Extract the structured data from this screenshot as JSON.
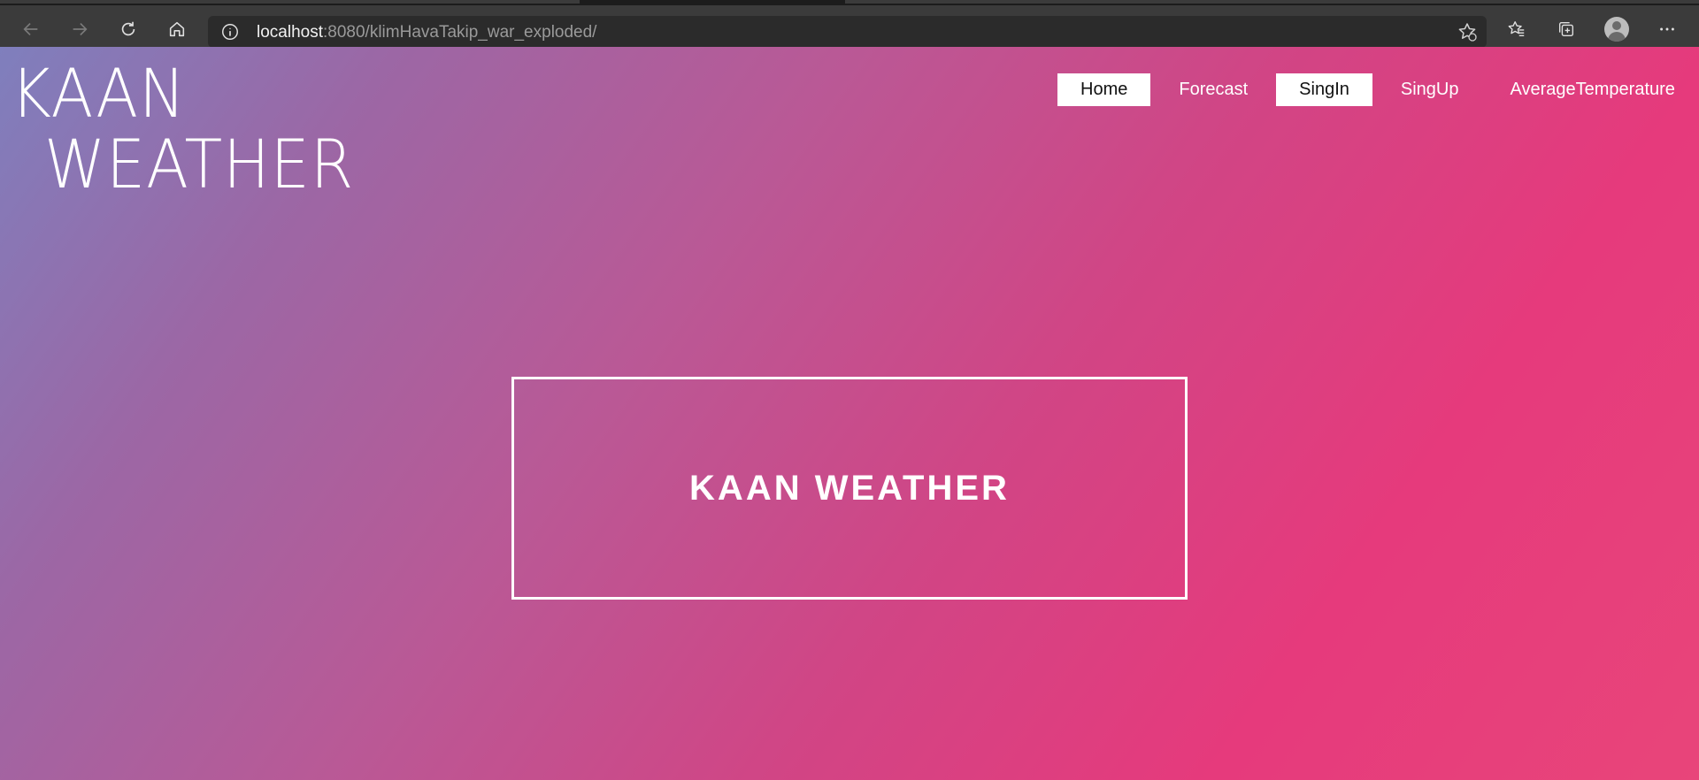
{
  "browser": {
    "url_host": "localhost",
    "url_rest": ":8080/klimHavaTakip_war_exploded/",
    "icons": [
      "back-icon",
      "forward-icon",
      "refresh-icon",
      "home-icon",
      "info-icon",
      "favorite-add-icon",
      "favorites-icon",
      "collections-icon",
      "profile-icon",
      "more-icon"
    ]
  },
  "site": {
    "logo_line1": "KAAN",
    "logo_line2": "WEATHER",
    "nav": [
      {
        "label": "Home",
        "active": true
      },
      {
        "label": "Forecast",
        "active": false
      },
      {
        "label": "SingIn",
        "active": true
      },
      {
        "label": "SingUp",
        "active": false
      },
      {
        "label": "AverageTemperature",
        "active": false
      }
    ],
    "hero_title": "KAAN WEATHER"
  },
  "colors": {
    "gradient_start": "#7f7fbd",
    "gradient_end": "#e63a7c",
    "text": "#ffffff",
    "active_nav_bg": "#ffffff"
  }
}
